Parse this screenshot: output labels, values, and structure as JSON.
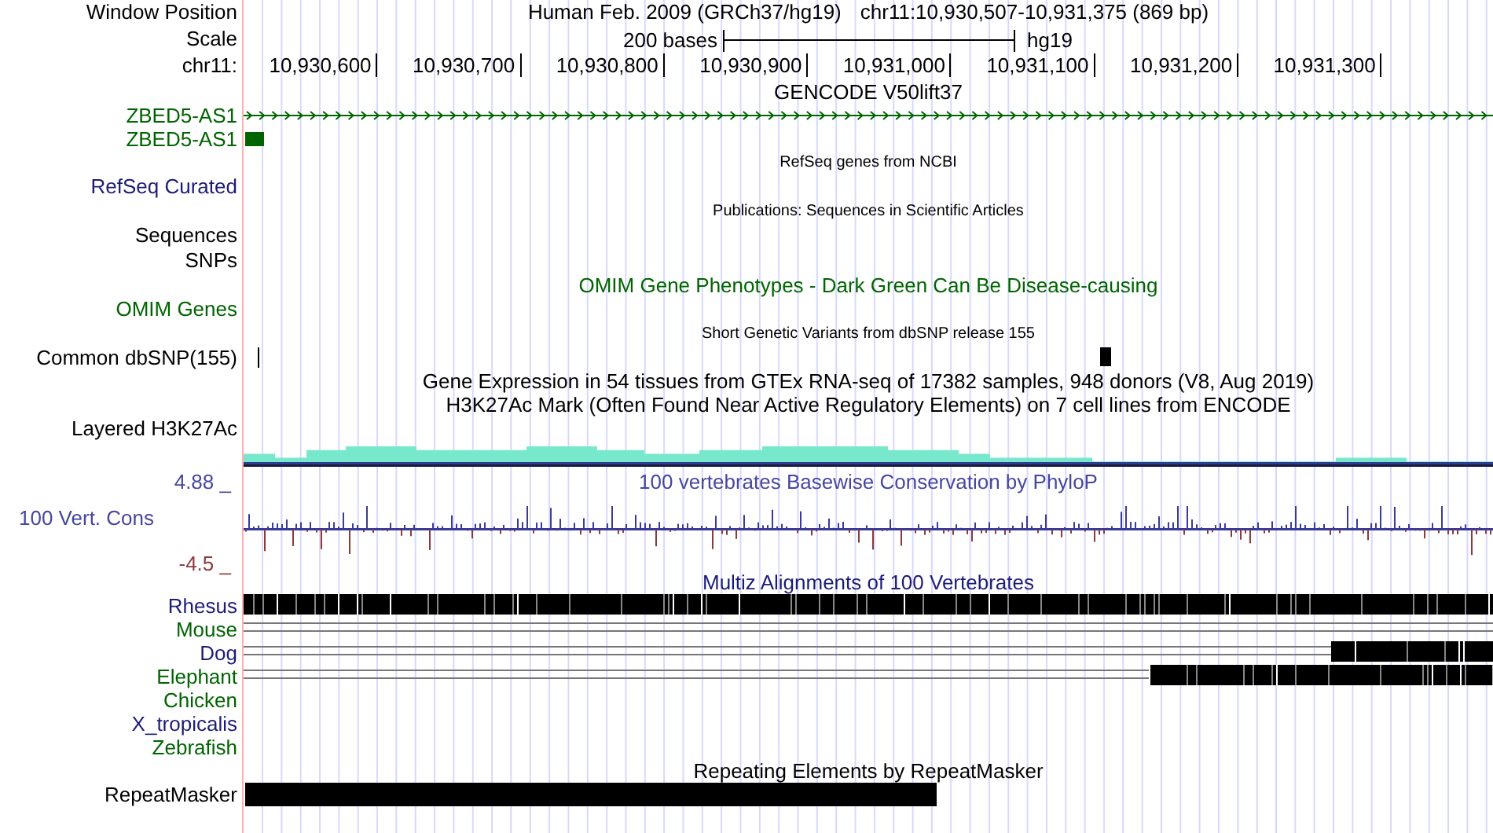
{
  "position": {
    "label": "Window Position",
    "assembly": "Human Feb. 2009 (GRCh37/hg19)",
    "range": "chr11:10,930,507-10,931,375 (869 bp)"
  },
  "scale": {
    "label": "Scale",
    "length": "200 bases",
    "assembly": "hg19"
  },
  "ruler": {
    "label": "chr11:",
    "ticks": [
      "10,930,600",
      "10,930,700",
      "10,930,800",
      "10,930,900",
      "10,931,000",
      "10,931,100",
      "10,931,200",
      "10,931,300"
    ]
  },
  "rows": [
    {
      "kind": "title",
      "text": "GENCODE V50lift37",
      "color": "#000000"
    },
    {
      "kind": "gene_line",
      "label": "ZBED5-AS1",
      "color": "#006400"
    },
    {
      "kind": "gene_block",
      "label": "ZBED5-AS1",
      "color": "#006400"
    },
    {
      "kind": "small_title",
      "text": "RefSeq genes from NCBI",
      "color": "#000000"
    },
    {
      "kind": "label",
      "label": "RefSeq Curated",
      "color": "#1c1c78"
    },
    {
      "kind": "small_title",
      "text": "Publications: Sequences in Scientific Articles",
      "color": "#000000"
    },
    {
      "kind": "label",
      "label": "Sequences",
      "color": "#000000"
    },
    {
      "kind": "label",
      "label": "SNPs",
      "color": "#000000"
    },
    {
      "kind": "title",
      "text": "OMIM Gene Phenotypes - Dark Green Can Be Disease-causing",
      "color": "#006400"
    },
    {
      "kind": "label",
      "label": "OMIM Genes",
      "color": "#006400"
    },
    {
      "kind": "small_title",
      "text": "Short Genetic Variants from dbSNP release 155",
      "color": "#000000"
    },
    {
      "kind": "snp",
      "label": "Common dbSNP(155)",
      "color": "#000000"
    },
    {
      "kind": "title",
      "text": "Gene Expression in 54 tissues from GTEx RNA-seq of 17382 samples, 948 donors (V8, Aug 2019)",
      "color": "#000000"
    },
    {
      "kind": "title",
      "text": "H3K27Ac Mark (Often Found Near Active Regulatory Elements) on 7 cell lines from ENCODE",
      "color": "#000000"
    },
    {
      "kind": "layered",
      "label": "Layered H3K27Ac",
      "color": "#000000"
    },
    {
      "kind": "conservation",
      "label": "100 Vert. Cons",
      "upper": "4.88 _",
      "lower": "-4.5 _",
      "text": "100 vertebrates Basewise Conservation by PhyloP",
      "color": "#4646a0"
    },
    {
      "kind": "title",
      "text": "Multiz Alignments of 100 Vertebrates",
      "color": "#1c1c78"
    },
    {
      "kind": "align_full",
      "label": "Rhesus",
      "color": "#1c1c78",
      "lines": false
    },
    {
      "kind": "align_none",
      "label": "Mouse",
      "color": "#006400",
      "lines": true
    },
    {
      "kind": "align_short",
      "label": "Dog",
      "color": "#1c1c78",
      "lines": true
    },
    {
      "kind": "align_long",
      "label": "Elephant",
      "color": "#006400",
      "lines": true
    },
    {
      "kind": "align_none",
      "label": "Chicken",
      "color": "#006400",
      "lines": false
    },
    {
      "kind": "align_none",
      "label": "X_tropicalis",
      "color": "#1c1c78",
      "lines": false
    },
    {
      "kind": "align_none",
      "label": "Zebrafish",
      "color": "#006400",
      "lines": false
    },
    {
      "kind": "title",
      "text": "Repeating Elements by RepeatMasker",
      "color": "#000000"
    },
    {
      "kind": "repeat",
      "label": "RepeatMasker",
      "color": "#000000"
    }
  ]
}
